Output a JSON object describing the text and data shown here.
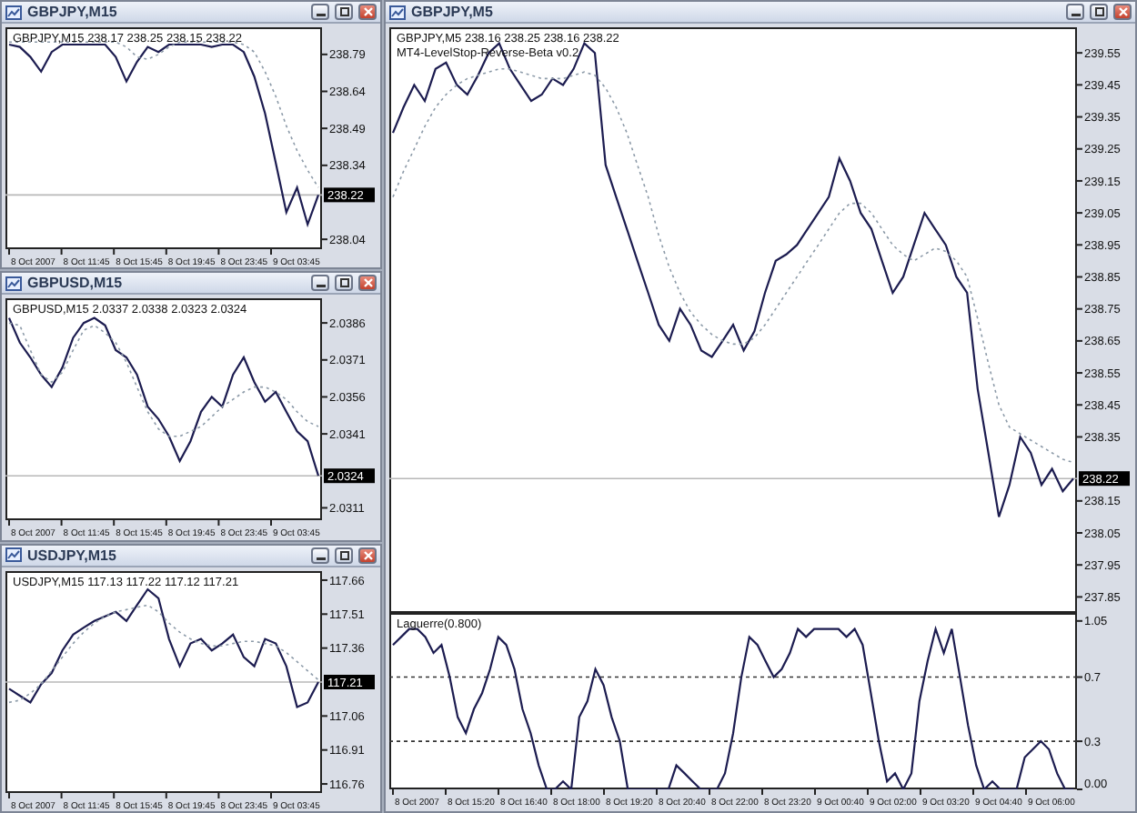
{
  "windows": [
    {
      "title": "GBPJPY,M15",
      "panes": [
        {
          "labels": [
            "GBPJPY,M15  238.17 238.25 238.15 238.22"
          ],
          "time_labels": [
            "8 Oct 2007",
            "8 Oct 11:45",
            "8 Oct 15:45",
            "8 Oct 19:45",
            "8 Oct 23:45",
            "9 Oct 03:45"
          ],
          "chart_data": {
            "type": "line",
            "ylim": [
              238.0,
              238.9
            ],
            "yticks": [
              238.79,
              238.64,
              238.49,
              238.34,
              238.04
            ],
            "ref_lines": [
              {
                "axis": "y",
                "value": 238.22,
                "label": "238.22"
              }
            ],
            "series": [
              {
                "color": "#1c1c50",
                "values": [
                  238.83,
                  238.82,
                  238.78,
                  238.72,
                  238.8,
                  238.83,
                  238.83,
                  238.83,
                  238.83,
                  238.83,
                  238.78,
                  238.68,
                  238.76,
                  238.82,
                  238.8,
                  238.83,
                  238.83,
                  238.83,
                  238.83,
                  238.82,
                  238.83,
                  238.83,
                  238.8,
                  238.7,
                  238.55,
                  238.35,
                  238.15,
                  238.25,
                  238.1,
                  238.22
                ]
              },
              {
                "color": "#8c9aa8",
                "line_style": "dotted",
                "values": [
                  238.84,
                  238.84,
                  238.84,
                  238.84,
                  238.84,
                  238.84,
                  238.84,
                  238.84,
                  238.84,
                  238.84,
                  238.84,
                  238.82,
                  238.78,
                  238.77,
                  238.79,
                  238.82,
                  238.84,
                  238.84,
                  238.84,
                  238.84,
                  238.84,
                  238.84,
                  238.83,
                  238.8,
                  238.72,
                  238.62,
                  238.5,
                  238.4,
                  238.32,
                  238.25
                ]
              }
            ]
          }
        }
      ]
    },
    {
      "title": "GBPUSD,M15",
      "panes": [
        {
          "labels": [
            "GBPUSD,M15  2.0337 2.0338 2.0323 2.0324"
          ],
          "time_labels": [
            "8 Oct 2007",
            "8 Oct 11:45",
            "8 Oct 15:45",
            "8 Oct 19:45",
            "8 Oct 23:45",
            "9 Oct 03:45"
          ],
          "chart_data": {
            "type": "line",
            "ylim": [
              2.0306,
              2.0396
            ],
            "yticks": [
              2.0386,
              2.0371,
              2.0356,
              2.0341,
              2.0311
            ],
            "ref_lines": [
              {
                "axis": "y",
                "value": 2.0324,
                "label": "2.0324"
              }
            ],
            "series": [
              {
                "color": "#1c1c50",
                "values": [
                  2.0388,
                  2.0378,
                  2.0372,
                  2.0365,
                  2.036,
                  2.0368,
                  2.038,
                  2.0386,
                  2.0388,
                  2.0385,
                  2.0375,
                  2.0372,
                  2.0365,
                  2.0352,
                  2.0347,
                  2.034,
                  2.033,
                  2.0338,
                  2.035,
                  2.0356,
                  2.0352,
                  2.0365,
                  2.0372,
                  2.0362,
                  2.0354,
                  2.0358,
                  2.035,
                  2.0342,
                  2.0338,
                  2.0324
                ]
              },
              {
                "color": "#8c9aa8",
                "line_style": "dotted",
                "values": [
                  2.0386,
                  2.0385,
                  2.0375,
                  2.0365,
                  2.0362,
                  2.0366,
                  2.0375,
                  2.0383,
                  2.0385,
                  2.0382,
                  2.0378,
                  2.037,
                  2.036,
                  2.035,
                  2.0343,
                  2.034,
                  2.034,
                  2.0342,
                  2.0344,
                  2.0348,
                  2.0352,
                  2.0355,
                  2.0358,
                  2.036,
                  2.036,
                  2.0358,
                  2.0355,
                  2.035,
                  2.0346,
                  2.0344
                ]
              }
            ]
          }
        }
      ]
    },
    {
      "title": "USDJPY,M15",
      "panes": [
        {
          "labels": [
            "USDJPY,M15  117.13 117.22 117.12 117.21"
          ],
          "time_labels": [
            "8 Oct 2007",
            "8 Oct 11:45",
            "8 Oct 15:45",
            "8 Oct 19:45",
            "8 Oct 23:45",
            "9 Oct 03:45"
          ],
          "chart_data": {
            "type": "line",
            "ylim": [
              116.72,
              117.7
            ],
            "yticks": [
              117.66,
              117.51,
              117.36,
              117.06,
              116.91,
              116.76
            ],
            "ref_lines": [
              {
                "axis": "y",
                "value": 117.21,
                "label": "117.21"
              }
            ],
            "series": [
              {
                "color": "#1c1c50",
                "values": [
                  117.18,
                  117.15,
                  117.12,
                  117.2,
                  117.25,
                  117.35,
                  117.42,
                  117.45,
                  117.48,
                  117.5,
                  117.52,
                  117.48,
                  117.55,
                  117.62,
                  117.58,
                  117.4,
                  117.28,
                  117.38,
                  117.4,
                  117.35,
                  117.38,
                  117.42,
                  117.32,
                  117.28,
                  117.4,
                  117.38,
                  117.28,
                  117.1,
                  117.12,
                  117.21
                ]
              },
              {
                "color": "#8c9aa8",
                "line_style": "dotted",
                "values": [
                  117.12,
                  117.13,
                  117.16,
                  117.2,
                  117.26,
                  117.32,
                  117.38,
                  117.43,
                  117.47,
                  117.5,
                  117.52,
                  117.53,
                  117.54,
                  117.55,
                  117.52,
                  117.47,
                  117.43,
                  117.4,
                  117.38,
                  117.37,
                  117.37,
                  117.38,
                  117.39,
                  117.39,
                  117.38,
                  117.37,
                  117.34,
                  117.3,
                  117.26,
                  117.22
                ]
              }
            ]
          }
        }
      ]
    },
    {
      "title": "GBPJPY,M5",
      "panes": [
        {
          "labels": [
            "GBPJPY,M5  238.16 238.25 238.16 238.22",
            "MT4-LevelStop-Reverse-Beta v0.2"
          ],
          "chart_data": {
            "type": "line",
            "ylim": [
              237.8,
              239.63
            ],
            "yticks": [
              239.55,
              239.45,
              239.35,
              239.25,
              239.15,
              239.05,
              238.95,
              238.85,
              238.75,
              238.65,
              238.55,
              238.45,
              238.35,
              238.15,
              238.05,
              237.95,
              237.85
            ],
            "ref_lines": [
              {
                "axis": "y",
                "value": 238.22,
                "label": "238.22"
              }
            ],
            "series": [
              {
                "color": "#1c1c50",
                "values": [
                  239.3,
                  239.38,
                  239.45,
                  239.4,
                  239.5,
                  239.52,
                  239.45,
                  239.42,
                  239.48,
                  239.55,
                  239.58,
                  239.5,
                  239.45,
                  239.4,
                  239.42,
                  239.47,
                  239.45,
                  239.5,
                  239.58,
                  239.55,
                  239.2,
                  239.1,
                  239.0,
                  238.9,
                  238.8,
                  238.7,
                  238.65,
                  238.75,
                  238.7,
                  238.62,
                  238.6,
                  238.65,
                  238.7,
                  238.62,
                  238.68,
                  238.8,
                  238.9,
                  238.92,
                  238.95,
                  239.0,
                  239.05,
                  239.1,
                  239.22,
                  239.15,
                  239.05,
                  239.0,
                  238.9,
                  238.8,
                  238.85,
                  238.95,
                  239.05,
                  239.0,
                  238.95,
                  238.85,
                  238.8,
                  238.5,
                  238.3,
                  238.1,
                  238.2,
                  238.35,
                  238.3,
                  238.2,
                  238.25,
                  238.18,
                  238.22
                ]
              },
              {
                "color": "#8c9aa8",
                "line_style": "dotted",
                "values": [
                  239.1,
                  239.18,
                  239.25,
                  239.32,
                  239.38,
                  239.42,
                  239.45,
                  239.47,
                  239.48,
                  239.49,
                  239.5,
                  239.5,
                  239.49,
                  239.48,
                  239.47,
                  239.47,
                  239.47,
                  239.48,
                  239.49,
                  239.48,
                  239.44,
                  239.38,
                  239.3,
                  239.2,
                  239.1,
                  238.98,
                  238.88,
                  238.8,
                  238.74,
                  238.7,
                  238.67,
                  238.65,
                  238.64,
                  238.64,
                  238.66,
                  238.7,
                  238.75,
                  238.8,
                  238.85,
                  238.9,
                  238.95,
                  239.0,
                  239.05,
                  239.08,
                  239.08,
                  239.05,
                  239.0,
                  238.95,
                  238.92,
                  238.9,
                  238.92,
                  238.94,
                  238.93,
                  238.9,
                  238.85,
                  238.72,
                  238.58,
                  238.45,
                  238.38,
                  238.36,
                  238.34,
                  238.32,
                  238.3,
                  238.28,
                  238.27
                ]
              }
            ]
          }
        },
        {
          "labels": [
            "Laguerre(0.800)"
          ],
          "time_labels": [
            "8 Oct 2007",
            "8 Oct 15:20",
            "8 Oct 16:40",
            "8 Oct 18:00",
            "8 Oct 19:20",
            "8 Oct 20:40",
            "8 Oct 22:00",
            "8 Oct 23:20",
            "9 Oct 00:40",
            "9 Oct 02:00",
            "9 Oct 03:20",
            "9 Oct 04:40",
            "9 Oct 06:00"
          ],
          "chart_data": {
            "type": "line",
            "ylim": [
              0,
              1.1
            ],
            "yticks": [
              1.05,
              0.7,
              0.3,
              {
                "value": 0,
                "label": "0.00"
              }
            ],
            "ref_lines": [
              {
                "axis": "y",
                "value": 0.7
              },
              {
                "axis": "y",
                "value": 0.3
              }
            ],
            "series": [
              {
                "color": "#1c1c50",
                "values": [
                  0.9,
                  0.95,
                  1,
                  1,
                  0.95,
                  0.85,
                  0.9,
                  0.7,
                  0.45,
                  0.35,
                  0.5,
                  0.6,
                  0.75,
                  0.95,
                  0.9,
                  0.75,
                  0.5,
                  0.35,
                  0.15,
                  0,
                  0,
                  0.05,
                  0,
                  0.45,
                  0.55,
                  0.75,
                  0.65,
                  0.45,
                  0.3,
                  0,
                  0,
                  0,
                  0,
                  0,
                  0,
                  0.15,
                  0.1,
                  0.05,
                  0,
                  0,
                  0,
                  0.1,
                  0.35,
                  0.7,
                  0.95,
                  0.9,
                  0.8,
                  0.7,
                  0.75,
                  0.85,
                  1,
                  0.95,
                  1,
                  1,
                  1,
                  1,
                  0.95,
                  1,
                  0.9,
                  0.6,
                  0.3,
                  0.05,
                  0.1,
                  0,
                  0.1,
                  0.55,
                  0.8,
                  1,
                  0.85,
                  1,
                  0.7,
                  0.4,
                  0.15,
                  0,
                  0.05,
                  0,
                  0,
                  0,
                  0.2,
                  0.25,
                  0.3,
                  0.25,
                  0.1,
                  0,
                  0
                ]
              }
            ]
          }
        }
      ]
    }
  ]
}
